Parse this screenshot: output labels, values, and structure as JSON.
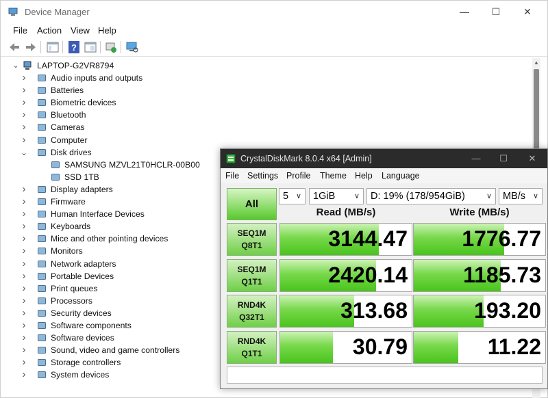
{
  "device_manager": {
    "title": "Device Manager",
    "menu": [
      "File",
      "Action",
      "View",
      "Help"
    ],
    "toolbar_icons": [
      "back-icon",
      "forward-icon",
      "show-hide-console-tree-icon",
      "help-icon",
      "properties-icon",
      "update-driver-icon",
      "scan-hardware-icon"
    ],
    "root": "LAPTOP-G2VR8794",
    "tree": [
      {
        "label": "Audio inputs and outputs",
        "expanded": false,
        "icon": "speaker-icon"
      },
      {
        "label": "Batteries",
        "expanded": false,
        "icon": "battery-icon"
      },
      {
        "label": "Biometric devices",
        "expanded": false,
        "icon": "fingerprint-icon"
      },
      {
        "label": "Bluetooth",
        "expanded": false,
        "icon": "bluetooth-icon"
      },
      {
        "label": "Cameras",
        "expanded": false,
        "icon": "camera-icon"
      },
      {
        "label": "Computer",
        "expanded": false,
        "icon": "computer-icon"
      },
      {
        "label": "Disk drives",
        "expanded": true,
        "icon": "disk-drive-icon"
      },
      {
        "label": "SAMSUNG MZVL21T0HCLR-00B00",
        "child": true,
        "icon": "disk-drive-icon"
      },
      {
        "label": "SSD 1TB",
        "child": true,
        "icon": "disk-drive-icon"
      },
      {
        "label": "Display adapters",
        "expanded": false,
        "icon": "display-adapter-icon"
      },
      {
        "label": "Firmware",
        "expanded": false,
        "icon": "firmware-icon"
      },
      {
        "label": "Human Interface Devices",
        "expanded": false,
        "icon": "hid-icon"
      },
      {
        "label": "Keyboards",
        "expanded": false,
        "icon": "keyboard-icon"
      },
      {
        "label": "Mice and other pointing devices",
        "expanded": false,
        "icon": "mouse-icon"
      },
      {
        "label": "Monitors",
        "expanded": false,
        "icon": "monitor-icon"
      },
      {
        "label": "Network adapters",
        "expanded": false,
        "icon": "network-icon"
      },
      {
        "label": "Portable Devices",
        "expanded": false,
        "icon": "portable-device-icon"
      },
      {
        "label": "Print queues",
        "expanded": false,
        "icon": "printer-icon"
      },
      {
        "label": "Processors",
        "expanded": false,
        "icon": "processor-icon"
      },
      {
        "label": "Security devices",
        "expanded": false,
        "icon": "security-icon"
      },
      {
        "label": "Software components",
        "expanded": false,
        "icon": "software-component-icon"
      },
      {
        "label": "Software devices",
        "expanded": false,
        "icon": "software-device-icon"
      },
      {
        "label": "Sound, video and game controllers",
        "expanded": false,
        "icon": "sound-icon"
      },
      {
        "label": "Storage controllers",
        "expanded": false,
        "icon": "storage-controller-icon"
      },
      {
        "label": "System devices",
        "expanded": false,
        "icon": "system-device-icon"
      }
    ]
  },
  "cdm": {
    "title": "CrystalDiskMark 8.0.4 x64 [Admin]",
    "menu": [
      "File",
      "Settings",
      "Profile",
      "Theme",
      "Help",
      "Language"
    ],
    "all_label": "All",
    "count": "5",
    "size": "1GiB",
    "drive": "D: 19% (178/954GiB)",
    "unit": "MB/s",
    "read_header": "Read (MB/s)",
    "write_header": "Write (MB/s)",
    "tests": [
      {
        "line1": "SEQ1M",
        "line2": "Q8T1",
        "read": "3144.47",
        "write": "1776.77",
        "read_fill": 0.75,
        "write_fill": 0.69
      },
      {
        "line1": "SEQ1M",
        "line2": "Q1T1",
        "read": "2420.14",
        "write": "1185.73",
        "read_fill": 0.73,
        "write_fill": 0.66
      },
      {
        "line1": "RND4K",
        "line2": "Q32T1",
        "read": "313.68",
        "write": "193.20",
        "read_fill": 0.56,
        "write_fill": 0.53
      },
      {
        "line1": "RND4K",
        "line2": "Q1T1",
        "read": "30.79",
        "write": "11.22",
        "read_fill": 0.4,
        "write_fill": 0.34
      }
    ],
    "colors": {
      "bar_green": "#49c41c",
      "title_bg": "#2b2b2b"
    }
  }
}
